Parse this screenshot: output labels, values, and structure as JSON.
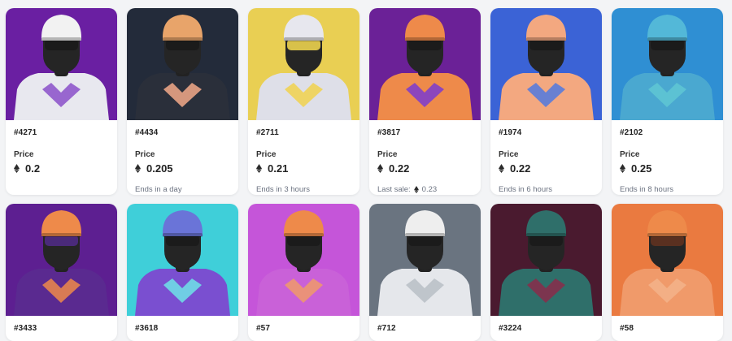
{
  "listing": {
    "price_label": "Price",
    "currency_icon": "ethereum-icon",
    "cards": [
      {
        "id": "#4271",
        "price": "0.2",
        "sub": "",
        "last_sale": "",
        "bg": "#6a1fa2",
        "helmet": "#f2f2f2",
        "jersey": "#e8e8ef",
        "accent": "#8a4fc9",
        "visor": "#1b1b1b"
      },
      {
        "id": "#4434",
        "price": "0.205",
        "sub": "Ends in a day",
        "last_sale": "",
        "bg": "#232b3a",
        "helmet": "#e8a46a",
        "jersey": "#2a2f3a",
        "accent": "#f3a98a",
        "visor": "#1b1b1b"
      },
      {
        "id": "#2711",
        "price": "0.21",
        "sub": "Ends in 3 hours",
        "last_sale": "",
        "bg": "#e9cf53",
        "helmet": "#e7e7ee",
        "jersey": "#dedfe8",
        "accent": "#f1d24c",
        "visor": "#d8c14a"
      },
      {
        "id": "#3817",
        "price": "0.22",
        "sub": "",
        "last_sale": "0.23",
        "last_sale_label": "Last sale:",
        "bg": "#6b2197",
        "helmet": "#ee8a4a",
        "jersey": "#ee8a4a",
        "accent": "#7a3ad0",
        "visor": "#1b1b1b"
      },
      {
        "id": "#1974",
        "price": "0.22",
        "sub": "Ends in 6 hours",
        "last_sale": "",
        "bg": "#3b63d6",
        "helmet": "#f3a880",
        "jersey": "#f3a880",
        "accent": "#4f79e0",
        "visor": "#1b1b1b"
      },
      {
        "id": "#2102",
        "price": "0.25",
        "sub": "Ends in 8 hours",
        "last_sale": "",
        "bg": "#2f8fd3",
        "helmet": "#53b8d8",
        "jersey": "#4aa8d0",
        "accent": "#5fc7d3",
        "visor": "#1b1b1b"
      },
      {
        "id": "#3433",
        "price": "",
        "sub": "",
        "last_sale": "",
        "bg": "#5d1f91",
        "helmet": "#ee8a4a",
        "jersey": "#5a2a90",
        "accent": "#ee8a4a",
        "visor": "#4a2a7a"
      },
      {
        "id": "#3618",
        "price": "",
        "sub": "",
        "last_sale": "",
        "bg": "#3fcfd9",
        "helmet": "#6a74d8",
        "jersey": "#7a4fd0",
        "accent": "#6fe3e8",
        "visor": "#1b1b1b"
      },
      {
        "id": "#57",
        "price": "",
        "sub": "",
        "last_sale": "",
        "bg": "#c555d9",
        "helmet": "#ee8a4a",
        "jersey": "#c961d8",
        "accent": "#f09a6a",
        "visor": "#1b1b1b"
      },
      {
        "id": "#712",
        "price": "",
        "sub": "",
        "last_sale": "",
        "bg": "#6a7480",
        "helmet": "#eeeeee",
        "jersey": "#e5e7eb",
        "accent": "#b9bec6",
        "visor": "#1b1b1b"
      },
      {
        "id": "#3224",
        "price": "",
        "sub": "",
        "last_sale": "",
        "bg": "#4a1a2f",
        "helmet": "#2f6f6a",
        "jersey": "#2f6f6a",
        "accent": "#8a2c4a",
        "visor": "#1b1b1b"
      },
      {
        "id": "#58",
        "price": "",
        "sub": "",
        "last_sale": "",
        "bg": "#ea7a40",
        "helmet": "#ee8a4a",
        "jersey": "#f09a6a",
        "accent": "#f3b38a",
        "visor": "#5a3020"
      }
    ]
  }
}
